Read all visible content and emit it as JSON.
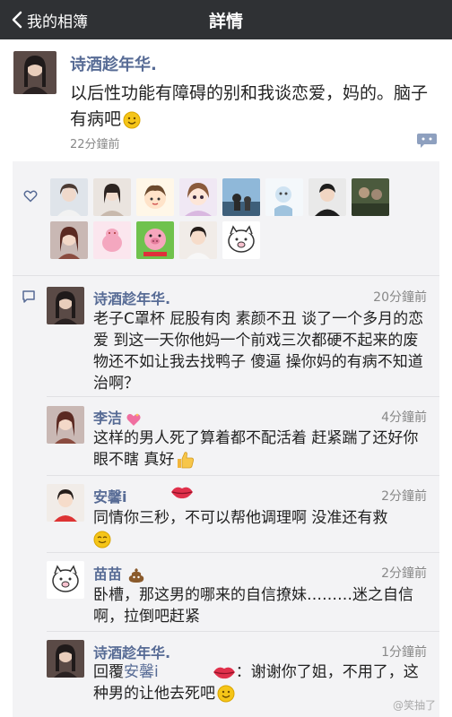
{
  "navbar": {
    "back_label": "我的相簿",
    "title": "詳情"
  },
  "post": {
    "author": "诗酒趁年华.",
    "text": "以后性功能有障碍的别和我谈恋爱，妈的。脑子有病吧",
    "time": "22分鐘前"
  },
  "comments": [
    {
      "author": "诗酒趁年华.",
      "time": "20分鐘前",
      "text": "老子C罩杯 屁股有肉 素颜不丑 谈了一个多月的恋爱 到这一天你他妈一个前戏三次都硬不起来的废物还不如让我去找鸭子 傻逼 操你妈的有病不知道治啊？"
    },
    {
      "author": "李洁",
      "time": "4分鐘前",
      "text": "这样的男人死了算着都不配活着 赶紧踹了还好你眼不瞎 真好"
    },
    {
      "author": "安馨i",
      "time": "2分鐘前",
      "text": "同情你三秒，不可以帮他调理啊 没准还有救"
    },
    {
      "author": "苗苗",
      "time": "2分鐘前",
      "text_line1": "卧槽，那这男的哪来的自信撩妹………迷之自信",
      "text_line2": "啊，拉倒吧赶紧"
    },
    {
      "author": "诗酒趁年华.",
      "time": "1分鐘前",
      "reply_prefix": "回覆",
      "reply_to": "安馨i",
      "text_line1": "：谢谢你了姐，不用了，这",
      "text_line2": "种男的让他去死吧"
    }
  ],
  "watermark": "@笑抽了",
  "icons": [
    "back-chevron-icon",
    "comment-bubble-icon",
    "heart-icon",
    "smile-emoji-icon",
    "thumbs-up-emoji-icon",
    "lips-emoji-icon",
    "pile-emoji-icon",
    "sparkling-heart-emoji-icon"
  ]
}
